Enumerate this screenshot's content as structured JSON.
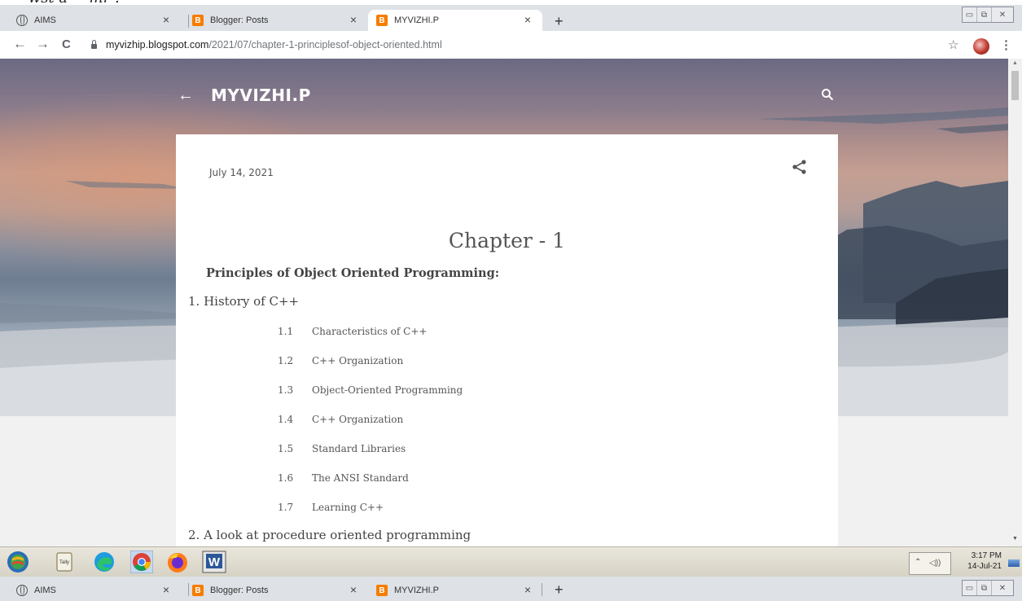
{
  "browser": {
    "tabs": [
      {
        "title": "AIMS",
        "icon": "globe-icon",
        "close": "×"
      },
      {
        "title": "Blogger: Posts",
        "icon": "blogger-icon",
        "close": "×"
      },
      {
        "title": "MYVIZHI.P",
        "icon": "blogger-icon",
        "close": "×",
        "active": true
      }
    ],
    "new_tab": "+",
    "window_controls": {
      "minimize": "▭",
      "restore": "⧉",
      "close": "✕"
    },
    "nav": {
      "back": "←",
      "forward": "→",
      "reload": "C"
    },
    "url_host": "myvizhip.blogspot.com",
    "url_path": "/2021/07/chapter-1-principlesof-object-oriented.html",
    "bookmark": "☆",
    "menu": "⋮",
    "bottom_tabs": [
      {
        "title": "AIMS",
        "icon": "globe-icon",
        "close": "×"
      },
      {
        "title": "Blogger: Posts",
        "icon": "blogger-icon",
        "close": "×"
      },
      {
        "title": "MYVIZHI.P",
        "icon": "blogger-icon",
        "close": "×"
      }
    ]
  },
  "blog": {
    "back_arrow": "←",
    "title": "MYVIZHI.P"
  },
  "post": {
    "date": "July 14, 2021",
    "chapter_title": "Chapter - 1",
    "subtitle": "Principles of Object Oriented Programming:",
    "items": [
      {
        "label": "1.  History of C++",
        "subitems": [
          {
            "num": "1.1",
            "text": "Characteristics of C++"
          },
          {
            "num": "1.2",
            "text": "C++ Organization"
          },
          {
            "num": "1.3",
            "text": "Object-Oriented Programming"
          },
          {
            "num": "1.4",
            "text": "C++ Organization"
          },
          {
            "num": "1.5",
            "text": "Standard Libraries"
          },
          {
            "num": "1.6",
            "text": "The ANSI Standard"
          },
          {
            "num": "1.7",
            "text": "Learning C++"
          }
        ]
      },
      {
        "label": "2.  A look at procedure oriented programming",
        "subitems": []
      }
    ]
  },
  "scrollbar": {
    "up": "▲",
    "down": "▼"
  },
  "taskbar": {
    "icons": [
      "windows-start-icon",
      "tally-erp9-icon",
      "edge-icon",
      "chrome-icon",
      "firefox-icon",
      "word-icon"
    ],
    "tally_label": "Tally",
    "word_letter": "W",
    "tray_chevron": "⌃",
    "tray_volume": "◁))",
    "clock_time": "3:17 PM",
    "clock_date": "14-Jul-21"
  },
  "colors": {
    "blogger": "#f57d00",
    "tab_strip": "#dee1e6",
    "taskbar": "#d6d2c4"
  }
}
